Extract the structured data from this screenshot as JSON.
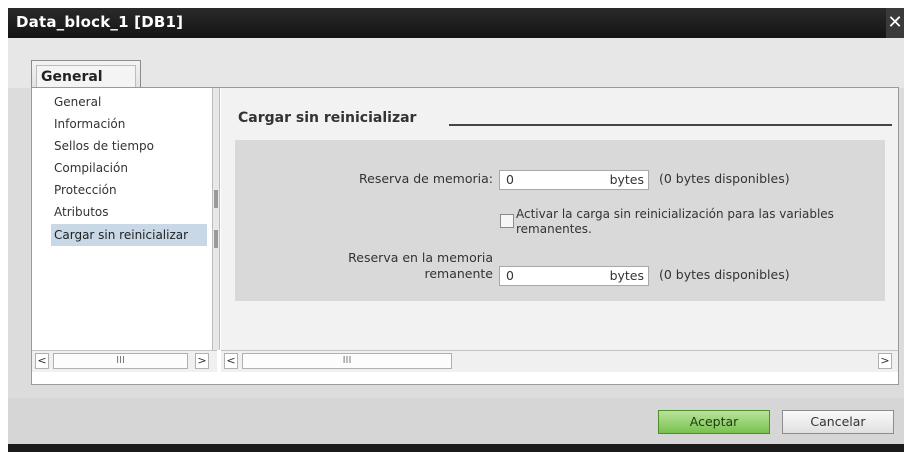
{
  "window": {
    "title": "Data_block_1 [DB1]",
    "close_glyph": "✕"
  },
  "tabs": [
    {
      "label": "General"
    }
  ],
  "nav": {
    "items": [
      {
        "label": "General"
      },
      {
        "label": "Información"
      },
      {
        "label": "Sellos de tiempo"
      },
      {
        "label": "Compilación"
      },
      {
        "label": "Protección"
      },
      {
        "label": "Atributos"
      },
      {
        "label": "Cargar sin reinicializar",
        "selected": true
      }
    ]
  },
  "section": {
    "title": "Cargar sin reinicializar",
    "memory_reserve": {
      "label": "Reserva de memoria:",
      "value": "0",
      "unit": "bytes",
      "available": "(0 bytes disponibles)"
    },
    "checkbox": {
      "label": "Activar la carga sin reinicialización para las variables remanentes.",
      "checked": false
    },
    "retentive_reserve": {
      "label_line1": "Reserva en la memoria",
      "label_line2": "remanente",
      "value": "0",
      "unit": "bytes",
      "available": "(0 bytes disponibles)"
    }
  },
  "scroll": {
    "left_glyph": "<",
    "right_glyph": ">",
    "thumb_glyph": "III"
  },
  "buttons": {
    "accept": "Aceptar",
    "cancel": "Cancelar"
  },
  "colors": {
    "accept_green": "#79c24e",
    "selected_nav": "#c8d8e6",
    "titlebar": "#1a1a1a"
  }
}
